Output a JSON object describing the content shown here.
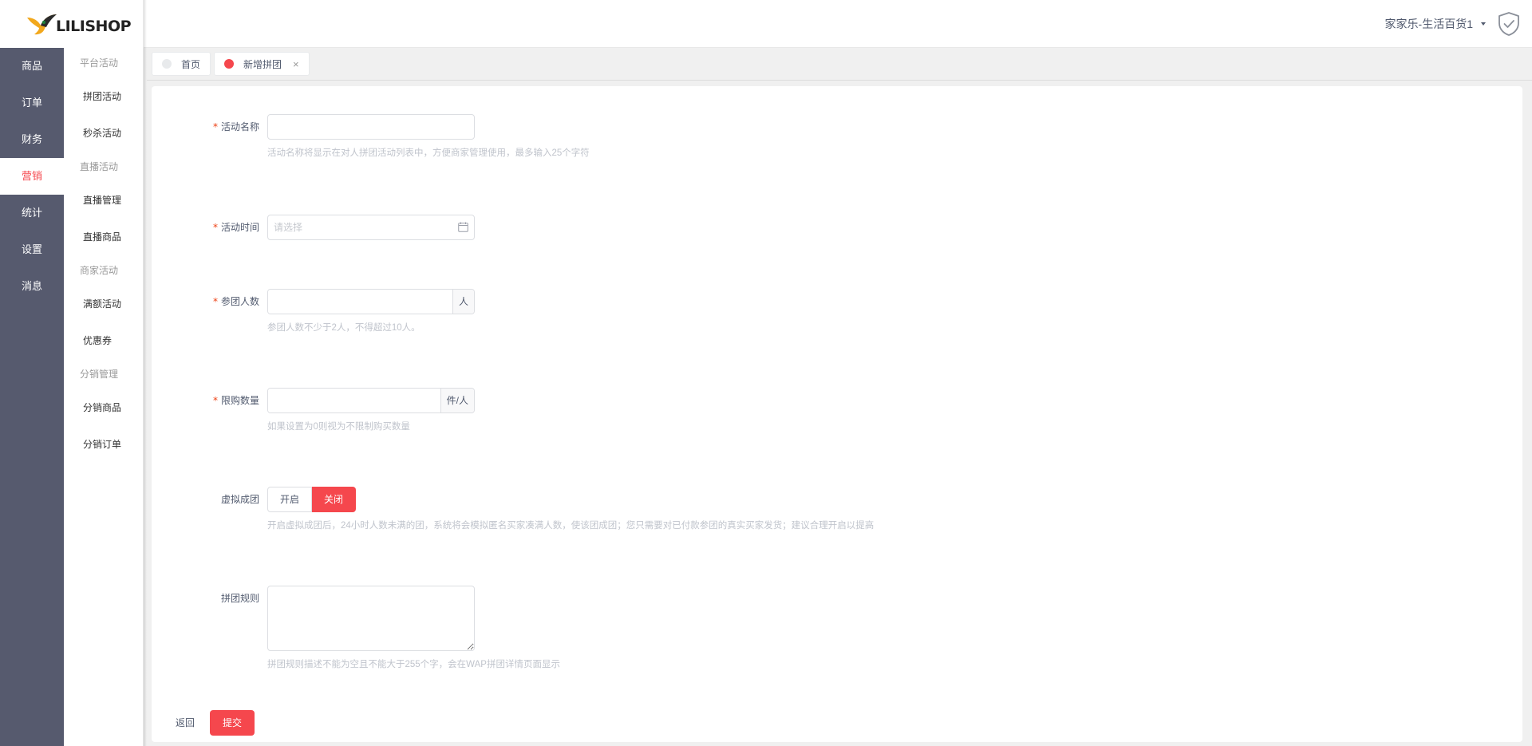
{
  "brand": {
    "logo_text": "LILISHOP"
  },
  "header": {
    "user_name": "家家乐-生活百货1"
  },
  "nav_primary": [
    {
      "label": "商品",
      "active": false
    },
    {
      "label": "订单",
      "active": false
    },
    {
      "label": "财务",
      "active": false
    },
    {
      "label": "营销",
      "active": true
    },
    {
      "label": "统计",
      "active": false
    },
    {
      "label": "设置",
      "active": false
    },
    {
      "label": "消息",
      "active": false
    }
  ],
  "nav_secondary": {
    "group_platform": "平台活动",
    "pintuan": "拼团活动",
    "seckill": "秒杀活动",
    "group_live": "直播活动",
    "live_manage": "直播管理",
    "live_goods": "直播商品",
    "group_merchant": "商家活动",
    "full_discount": "满额活动",
    "coupon": "优惠券",
    "group_distribution": "分销管理",
    "dist_goods": "分销商品",
    "dist_orders": "分销订单"
  },
  "tabs": [
    {
      "label": "首页",
      "active": false
    },
    {
      "label": "新增拼团",
      "active": true,
      "close": "×"
    }
  ],
  "form": {
    "required_mark": "*",
    "name": {
      "label": "活动名称",
      "value": "",
      "hint": "活动名称将显示在对人拼团活动列表中，方便商家管理使用，最多输入25个字符"
    },
    "time": {
      "label": "活动时间",
      "placeholder": "请选择"
    },
    "people": {
      "label": "参团人数",
      "value": "",
      "suffix": "人",
      "hint": "参团人数不少于2人，不得超过10人。"
    },
    "limit": {
      "label": "限购数量",
      "value": "",
      "suffix": "件/人",
      "hint": "如果设置为0则视为不限制购买数量"
    },
    "virtual": {
      "label": "虚拟成团",
      "on": "开启",
      "off": "关闭",
      "selected": "关闭",
      "hint": "开启虚拟成团后，24小时人数未满的团，系统将会模拟匿名买家凑满人数，使该团成团；您只需要对已付款参团的真实买家发货；建议合理开启以提高"
    },
    "rules": {
      "label": "拼团规则",
      "value": "",
      "hint": "拼团规则描述不能为空且不能大于255个字，会在WAP拼团详情页面显示"
    },
    "back_label": "返回",
    "submit_label": "提交"
  },
  "colors": {
    "accent": "#f5474d",
    "nav_bg": "#565a6e"
  }
}
